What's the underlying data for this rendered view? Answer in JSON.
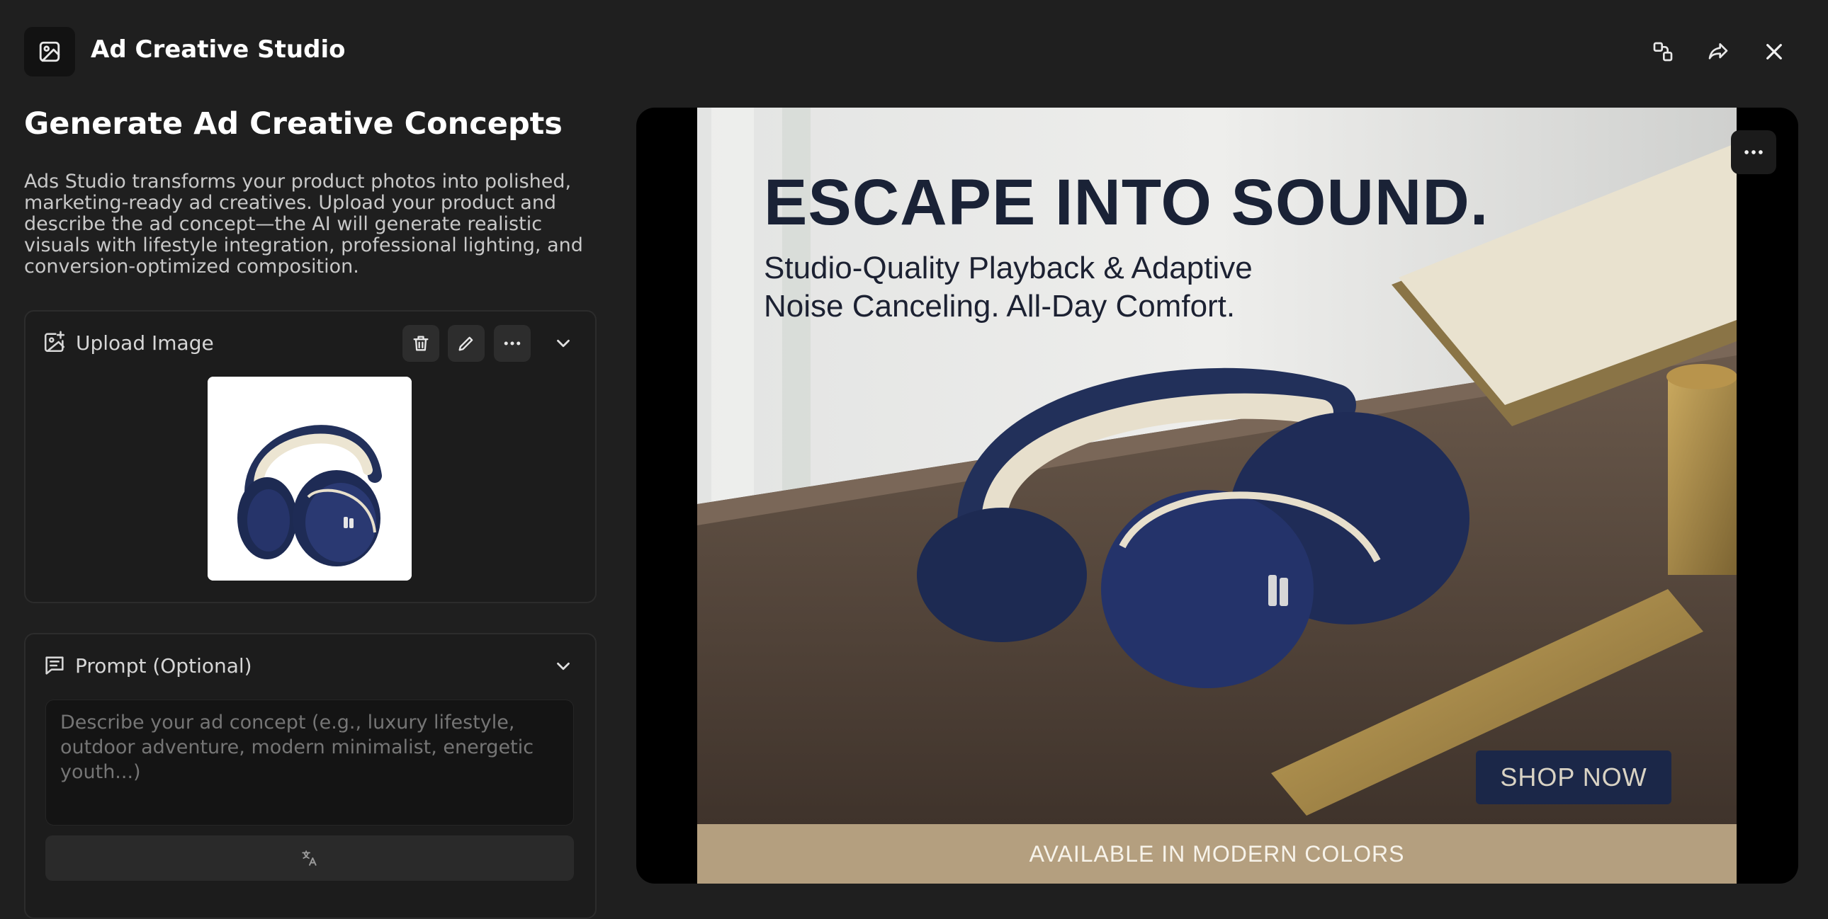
{
  "header": {
    "app_icon": "image-icon",
    "title": "Ad Creative Studio",
    "actions": [
      {
        "name": "compare-icon"
      },
      {
        "name": "share-icon"
      },
      {
        "name": "close-icon"
      }
    ]
  },
  "intro": {
    "title": "Generate Ad Creative Concepts",
    "description": "Ads Studio transforms your product photos into polished, marketing-ready ad creatives. Upload your product and describe the ad concept—the AI will generate realistic visuals with lifestyle integration, professional lighting, and conversion-optimized composition."
  },
  "upload": {
    "icon": "image-plus-icon",
    "label": "Upload Image",
    "actions": [
      "trash-icon",
      "pencil-icon",
      "more-horizontal-icon"
    ],
    "collapse_icon": "chevron-down-icon"
  },
  "prompt": {
    "icon": "message-icon",
    "label": "Prompt (Optional)",
    "placeholder": "Describe your ad concept (e.g., luxury lifestyle, outdoor adventure, modern minimalist, energetic youth...)",
    "translate_icon": "translate-icon"
  },
  "preview": {
    "headline": "ESCAPE INTO SOUND.",
    "subhead_line1": "Studio-Quality Playback & Adaptive",
    "subhead_line2": "Noise Canceling. All-Day Comfort.",
    "cta": "SHOP NOW",
    "footer": "AVAILABLE IN MODERN COLORS",
    "menu_icon": "more-horizontal-icon"
  },
  "colors": {
    "background": "#1f1f1f",
    "card": "#1c1c1c",
    "headphone_navy": "#23305a",
    "headphone_cream": "#e7dfcc",
    "cta_bg": "#1b2748",
    "footer_band": "#b49f7f"
  }
}
